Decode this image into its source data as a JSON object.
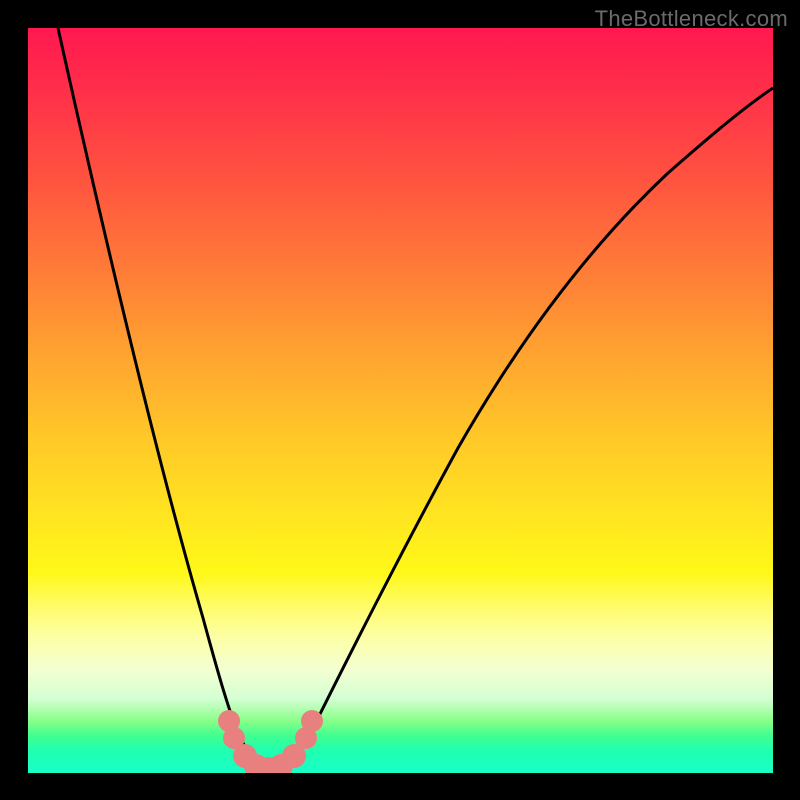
{
  "watermark": "TheBottleneck.com",
  "chart_data": {
    "type": "line",
    "title": "",
    "xlabel": "",
    "ylabel": "",
    "xlim": [
      0,
      100
    ],
    "ylim": [
      0,
      100
    ],
    "grid": false,
    "series": [
      {
        "name": "bottleneck-curve",
        "x": [
          4,
          8,
          12,
          16,
          20,
          22,
          24,
          26,
          27,
          28,
          29,
          30,
          31,
          32,
          33,
          34,
          36,
          40,
          45,
          50,
          55,
          60,
          65,
          70,
          75,
          80,
          85,
          90,
          95,
          100
        ],
        "values": [
          100,
          82,
          64,
          46,
          28,
          20,
          13,
          7,
          4,
          2,
          1,
          0.5,
          0.5,
          1,
          2,
          3.5,
          7,
          14,
          23,
          31,
          38,
          45,
          52,
          58,
          64,
          69,
          74,
          78,
          81,
          83
        ]
      }
    ],
    "markers": {
      "name": "highlighted-range",
      "x": [
        26,
        27.5,
        29,
        30.5,
        32,
        33.5
      ],
      "values": [
        7,
        3,
        1,
        1,
        2.5,
        5
      ]
    },
    "colors": {
      "curve": "#000000",
      "markers": "#e98080",
      "gradient_top": "#ff1850",
      "gradient_bottom": "#18ffc8"
    }
  }
}
